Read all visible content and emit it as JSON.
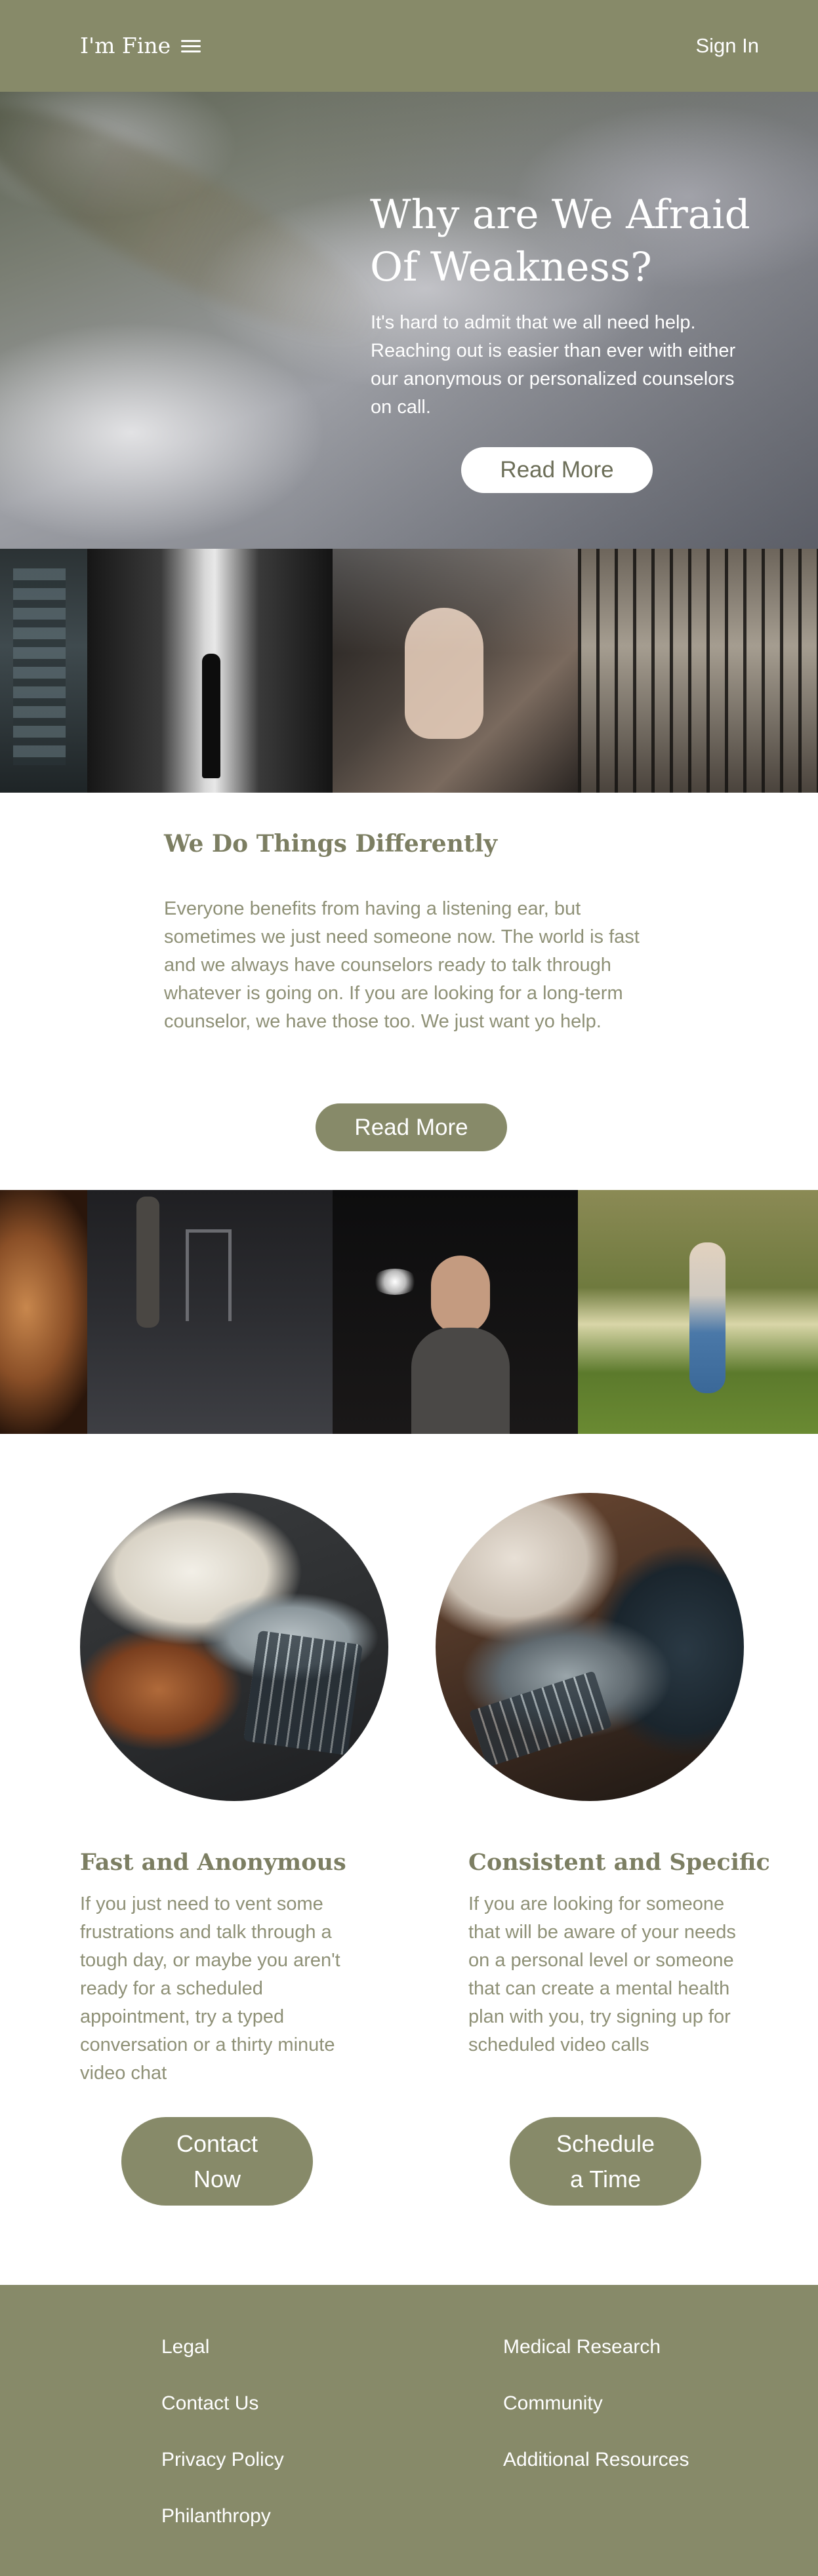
{
  "nav": {
    "brand": "I'm Fine",
    "signin": "Sign In"
  },
  "hero": {
    "title_line1": "Why are We Afraid",
    "title_line2": "Of Weakness?",
    "text": "It's hard to admit that we all need help. Reaching out is easier than ever with either our anonymous or personalized counselors on call.",
    "button": "Read More"
  },
  "different": {
    "title": "We Do Things Differently",
    "text": "Everyone benefits from having a listening ear, but sometimes we just need someone now. The world is fast and we always have counselors ready to talk through whatever is going on. If you are looking for a long-term counselor, we have those too. We just want yo help.",
    "button": "Read More"
  },
  "features": [
    {
      "title": "Fast and Anonymous",
      "text": "If you just need to vent some frustrations and talk through a tough day,  or maybe you aren't ready for a scheduled appointment, try a typed conversation or a thirty minute video chat",
      "button_line1": "Contact",
      "button_line2": "Now"
    },
    {
      "title": "Consistent and Specific",
      "text": "If you are looking for someone that will be aware of your needs on a personal level or someone that can create a mental health plan with you, try signing up for scheduled video calls",
      "button_line1": "Schedule",
      "button_line2": "a Time"
    }
  ],
  "footer": {
    "left": [
      "Legal",
      "Contact Us",
      "Privacy Policy",
      "Philanthropy"
    ],
    "right": [
      "Medical Research",
      "Community",
      "Additional Resources"
    ]
  },
  "colors": {
    "olive": "#878a69",
    "heading": "#7c7e62",
    "body_text": "#8e9076"
  }
}
